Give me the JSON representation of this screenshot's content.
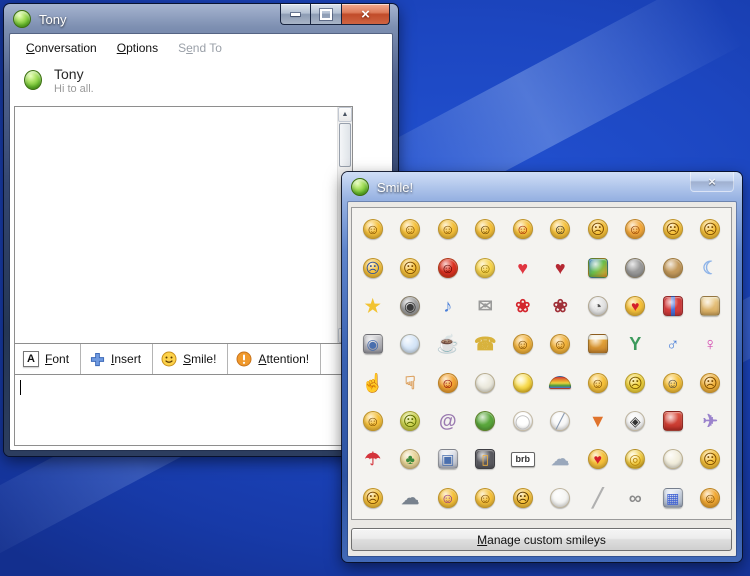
{
  "desktop": {
    "wallpaper_color": "#1c46c0"
  },
  "chat_window": {
    "title": "Tony",
    "window_icon": "green-status-sphere",
    "caption_buttons": {
      "minimize": "",
      "maximize": "",
      "close_glyph": "×"
    },
    "menu": [
      {
        "label": "Conversation",
        "accesskey": "C",
        "enabled": true
      },
      {
        "label": "Options",
        "accesskey": "O",
        "enabled": true
      },
      {
        "label": "Send To",
        "accesskey": "e",
        "enabled": false
      }
    ],
    "contact": {
      "name": "Tony",
      "status_message": "Hi to all.",
      "presence": "online",
      "presence_color": "#7ed03e"
    },
    "message_history": {
      "text": ""
    },
    "scrollbar": {
      "up_glyph": "▲",
      "down_glyph": "▼"
    },
    "toolbar": [
      {
        "label": "Font",
        "accesskey": "F",
        "icon": "font-icon"
      },
      {
        "label": "Insert",
        "accesskey": "I",
        "icon": "insert-plus-icon"
      },
      {
        "label": "Smile!",
        "accesskey": "S",
        "icon": "smiley-icon"
      },
      {
        "label": "Attention!",
        "accesskey": "A",
        "icon": "attention-icon"
      }
    ],
    "input": {
      "value": ""
    }
  },
  "smiley_window": {
    "title": "Smile!",
    "window_icon": "green-status-sphere",
    "close_glyph": "×",
    "manage_button": {
      "label": "Manage custom smileys",
      "accesskey": "M"
    },
    "grid": {
      "columns": 10,
      "rows": 8,
      "items": [
        {
          "n": "smile",
          "s": "c",
          "bg": "#f6c13a",
          "g": "☺",
          "fg": "#7a4a00"
        },
        {
          "n": "open-mouthed-grin",
          "s": "c",
          "bg": "#f6c13a",
          "g": "☺",
          "fg": "#7a4a00"
        },
        {
          "n": "wink",
          "s": "c",
          "bg": "#f6c13a",
          "g": "☺",
          "fg": "#7a4a00"
        },
        {
          "n": "surprised",
          "s": "c",
          "bg": "#f6c13a",
          "g": "☺",
          "fg": "#5a3a00"
        },
        {
          "n": "tongue-out",
          "s": "c",
          "bg": "#f6c13a",
          "g": "☺",
          "fg": "#9a1a00"
        },
        {
          "n": "cool-sunglasses",
          "s": "c",
          "bg": "#f6c13a",
          "g": "☺",
          "fg": "#222222"
        },
        {
          "n": "neutral",
          "s": "c",
          "bg": "#f6c13a",
          "g": "☹",
          "fg": "#7a4a00"
        },
        {
          "n": "embarrassed-blush",
          "s": "c",
          "bg": "#f4a93c",
          "g": "☺",
          "fg": "#8a3a00"
        },
        {
          "n": "confused",
          "s": "c",
          "bg": "#f6c13a",
          "g": "☹",
          "fg": "#7a4a00"
        },
        {
          "n": "sad",
          "s": "c",
          "bg": "#f6c13a",
          "g": "☹",
          "fg": "#7a4a00"
        },
        {
          "n": "crying",
          "s": "c",
          "bg": "#f6c13a",
          "g": "☹",
          "fg": "#33539a"
        },
        {
          "n": "disappointed",
          "s": "c",
          "bg": "#f6c13a",
          "g": "☹",
          "fg": "#7a4a00"
        },
        {
          "n": "devil",
          "s": "c",
          "bg": "#dd3322",
          "g": "☺",
          "fg": "#550000"
        },
        {
          "n": "angel",
          "s": "c",
          "bg": "#f8d44c",
          "g": "☺",
          "fg": "#8a6a00"
        },
        {
          "n": "heart",
          "s": "g",
          "g": "♥",
          "fg": "#e03540"
        },
        {
          "n": "broken-heart",
          "s": "g",
          "g": "♥",
          "fg": "#b52832"
        },
        {
          "n": "butterfly",
          "s": "s",
          "bg": "linear-gradient(135deg,#4a8ad4 0%,#6abf4a 50%,#f0a02c 100%)"
        },
        {
          "n": "cat",
          "s": "c",
          "bg": "#9a9a9a"
        },
        {
          "n": "dog",
          "s": "c",
          "bg": "#c49a5c"
        },
        {
          "n": "moon",
          "s": "g",
          "g": "☾",
          "fg": "#8fb4e8"
        },
        {
          "n": "star",
          "s": "g",
          "g": "★",
          "fg": "#f2c332"
        },
        {
          "n": "film-reel",
          "s": "c",
          "bg": "#9e9e9e",
          "g": "◉",
          "fg": "#3a3a3a"
        },
        {
          "n": "music-note",
          "s": "g",
          "g": "♪",
          "fg": "#4a7fd8"
        },
        {
          "n": "email-envelope",
          "s": "g",
          "g": "✉",
          "fg": "#9a9a9a"
        },
        {
          "n": "rose",
          "s": "g",
          "g": "❀",
          "fg": "#d4262e"
        },
        {
          "n": "wilted-rose",
          "s": "g",
          "g": "❀",
          "fg": "#a03038"
        },
        {
          "n": "clock",
          "s": "c",
          "bg": "#e4e4e4",
          "g": "◔",
          "fg": "#555555"
        },
        {
          "n": "blowing-kiss",
          "s": "c",
          "bg": "#f6c13a",
          "g": "♥",
          "fg": "#d4202a"
        },
        {
          "n": "gift",
          "s": "s",
          "bg": "linear-gradient(90deg,#d43c3c 38%,#4a6fd8 38%,#4a6fd8 62%,#d43c3c 62%)"
        },
        {
          "n": "birthday-cake",
          "s": "s",
          "bg": "linear-gradient(180deg,#f0e0b0 0%,#e8c480 30%,#d4a85c 100%)"
        },
        {
          "n": "camera",
          "s": "s",
          "bg": "linear-gradient(180deg,#d0d0d4,#9a9aa2)",
          "g": "◉",
          "fg": "#4a6fae"
        },
        {
          "n": "light-bulb",
          "s": "c",
          "bg": "#d6e6f8"
        },
        {
          "n": "coffee-cup",
          "s": "g",
          "g": "☕",
          "fg": "#8a5a32"
        },
        {
          "n": "telephone",
          "s": "g",
          "g": "☎",
          "fg": "#d8b23c"
        },
        {
          "n": "hug-left",
          "s": "c",
          "bg": "#f2b33c",
          "g": "☺",
          "fg": "#7a4a00"
        },
        {
          "n": "hug-right",
          "s": "c",
          "bg": "#f2b33c",
          "g": "☺",
          "fg": "#7a4a00"
        },
        {
          "n": "beer-mug",
          "s": "s",
          "bg": "linear-gradient(180deg,#f4f0e0 0%,#f4f0e0 25%,#e8a83c 25%,#c8842c 100%)"
        },
        {
          "n": "cocktail",
          "s": "g",
          "g": "Y",
          "fg": "#3c9a5c"
        },
        {
          "n": "male-symbol",
          "s": "g",
          "g": "♂",
          "fg": "#4a7fd8"
        },
        {
          "n": "female-symbol",
          "s": "g",
          "g": "♀",
          "fg": "#d44ab0"
        },
        {
          "n": "thumbs-up",
          "s": "g",
          "g": "☝",
          "fg": "#dca05e"
        },
        {
          "n": "thumbs-down",
          "s": "g",
          "g": "☟",
          "fg": "#dca05e"
        },
        {
          "n": "vampire-grin",
          "s": "c",
          "bg": "#f2a333",
          "g": "☺",
          "fg": "#8a0000"
        },
        {
          "n": "goat",
          "s": "c",
          "bg": "#eceade"
        },
        {
          "n": "sun",
          "s": "c",
          "bg": "radial-gradient(circle at 40% 35%,#fdf2a0,#f6d43c 60%,#e8b01c)"
        },
        {
          "n": "rainbow",
          "s": "a",
          "bg": "linear-gradient(180deg,#d43c3c 0%,#e8922c 30%,#e8d23c 55%,#4a9a3c 80%,#4a6fd8 100%)"
        },
        {
          "n": "dont-tell-anyone",
          "s": "c",
          "bg": "#f6c13a",
          "g": "☺",
          "fg": "#7a4a00"
        },
        {
          "n": "nervous",
          "s": "c",
          "bg": "#f2d43c",
          "g": "☹",
          "fg": "#7a5a00"
        },
        {
          "n": "nerd-glasses",
          "s": "c",
          "bg": "#f6c13a",
          "g": "☺",
          "fg": "#444444"
        },
        {
          "n": "sarcastic",
          "s": "c",
          "bg": "#f2b33c",
          "g": "☹",
          "fg": "#7a4a00"
        },
        {
          "n": "telling-secret",
          "s": "c",
          "bg": "#f6c13a",
          "g": "☺",
          "fg": "#7a4a00"
        },
        {
          "n": "sick",
          "s": "c",
          "bg": "#cdd44e",
          "g": "☹",
          "fg": "#5a6a00"
        },
        {
          "n": "snail",
          "s": "g",
          "g": "@",
          "fg": "#9a7ab0"
        },
        {
          "n": "turtle",
          "s": "c",
          "bg": "#5aa83c"
        },
        {
          "n": "dinner-plate",
          "s": "c",
          "bg": "#ffffff",
          "g": "◯",
          "fg": "#c0c0c0"
        },
        {
          "n": "bowl",
          "s": "c",
          "bg": "#f8f8f8",
          "g": "╱",
          "fg": "#8a9ab0"
        },
        {
          "n": "pizza-slice",
          "s": "g",
          "g": "▼",
          "fg": "#e0732c"
        },
        {
          "n": "soccer-ball",
          "s": "c",
          "bg": "#f4f4f4",
          "g": "◈",
          "fg": "#333333"
        },
        {
          "n": "car",
          "s": "s",
          "bg": "linear-gradient(180deg,#e05848,#c03028)"
        },
        {
          "n": "airplane",
          "s": "g",
          "g": "✈",
          "fg": "#9a82cc"
        },
        {
          "n": "umbrella",
          "s": "g",
          "g": "☂",
          "fg": "#d4343c"
        },
        {
          "n": "island-palm",
          "s": "c",
          "bg": "#e8d498",
          "g": "♣",
          "fg": "#3c8a3c"
        },
        {
          "n": "computer",
          "s": "s",
          "bg": "linear-gradient(180deg,#e8eaf0,#b8bcc8)",
          "g": "▣",
          "fg": "#4a6fae"
        },
        {
          "n": "mobile-phone",
          "s": "s",
          "bg": "#5a5a60",
          "g": "▯",
          "fg": "#f0b040"
        },
        {
          "n": "brb-sign",
          "s": "t",
          "g": "brb",
          "fg": "#333333",
          "bg": "#ffffff"
        },
        {
          "n": "rain-cloud",
          "s": "g",
          "g": "☁",
          "fg": "#9aa8bc"
        },
        {
          "n": "kissing-couple",
          "s": "c",
          "bg": "#f6c13a",
          "g": "♥",
          "fg": "#d4202a"
        },
        {
          "n": "coins",
          "s": "c",
          "bg": "radial-gradient(circle at 38% 32%,#fdf0a8,#f0c83c 55%,#d0a01c)",
          "g": "◎",
          "fg": "#b8860b"
        },
        {
          "n": "sheep",
          "s": "c",
          "bg": "#f2eedd"
        },
        {
          "n": "thinking",
          "s": "c",
          "bg": "#f6c13a",
          "g": "☹",
          "fg": "#7a4a00"
        },
        {
          "n": "annoyed",
          "s": "c",
          "bg": "#f6c13a",
          "g": "☹",
          "fg": "#7a4a00"
        },
        {
          "n": "storm-cloud",
          "s": "g",
          "g": "☁",
          "fg": "#78828e"
        },
        {
          "n": "party",
          "s": "c",
          "bg": "#f6c13a",
          "g": "☺",
          "fg": "#8a2a8a"
        },
        {
          "n": "eye-roll",
          "s": "c",
          "bg": "#f6c13a",
          "g": "☺",
          "fg": "#7a4a00"
        },
        {
          "n": "yawn",
          "s": "c",
          "bg": "#f6c13a",
          "g": "☹",
          "fg": "#5a3a00"
        },
        {
          "n": "bunny",
          "s": "c",
          "bg": "#f6f6f4",
          "g": "",
          "fg": "#d88a9a"
        },
        {
          "n": "cigarette",
          "s": "g",
          "g": "╱",
          "fg": "#b0b0b0"
        },
        {
          "n": "handcuffs",
          "s": "g",
          "g": "∞",
          "fg": "#8a8a8a"
        },
        {
          "n": "game-console",
          "s": "s",
          "bg": "linear-gradient(180deg,#dce4f0,#a8b4c8)",
          "g": "▦",
          "fg": "#3c5fd4"
        },
        {
          "n": "hug",
          "s": "c",
          "bg": "#f2a933",
          "g": "☺",
          "fg": "#7a4a00"
        }
      ]
    }
  }
}
